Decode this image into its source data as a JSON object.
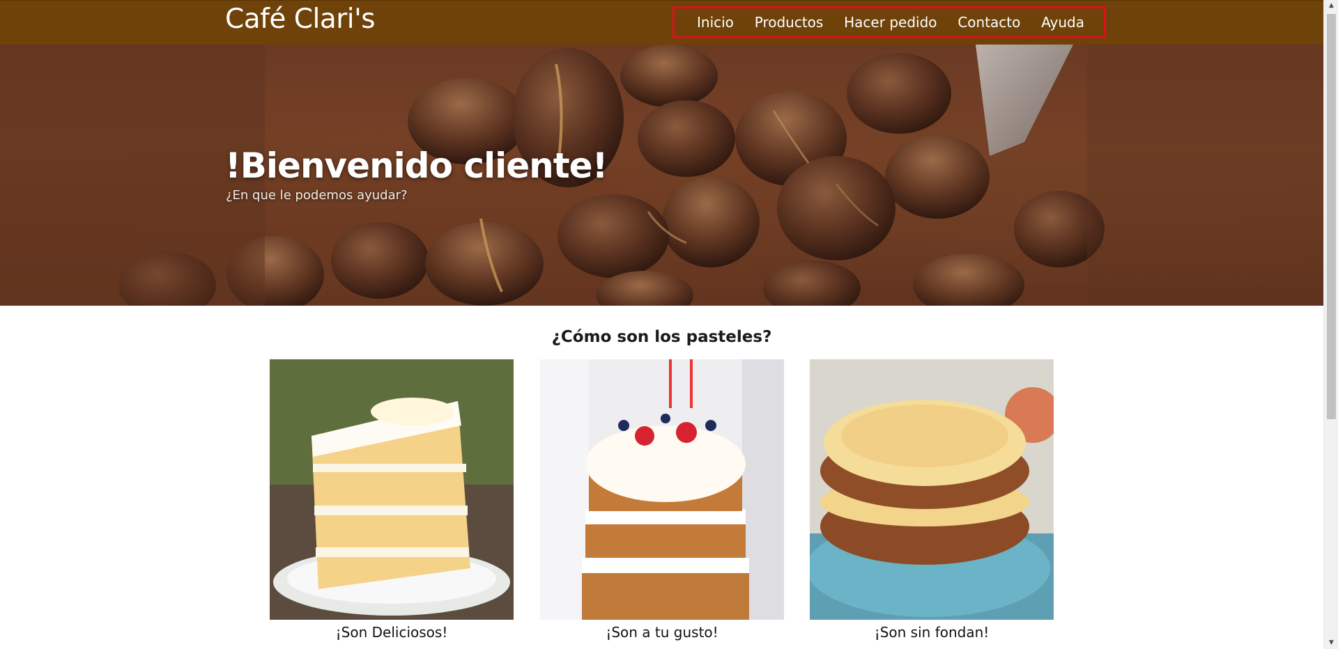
{
  "header": {
    "brand": "Café Clari's",
    "nav": [
      "Inicio",
      "Productos",
      "Hacer pedido",
      "Contacto",
      "Ayuda"
    ]
  },
  "hero": {
    "title": "!Bienvenido cliente!",
    "subtitle": "¿En que le podemos ayudar?"
  },
  "cakes": {
    "title": "¿Cómo son los pasteles?",
    "items": [
      {
        "caption": "¡Son Deliciosos!"
      },
      {
        "caption": "¡Son a tu gusto!"
      },
      {
        "caption": "¡Son sin fondan!"
      }
    ]
  },
  "colors": {
    "header_bg": "#6e4209",
    "nav_highlight": "#e0101a",
    "hero_bg": "#6b3a23"
  },
  "icons": [
    "scroll-up-arrow-icon",
    "scroll-down-arrow-icon"
  ]
}
